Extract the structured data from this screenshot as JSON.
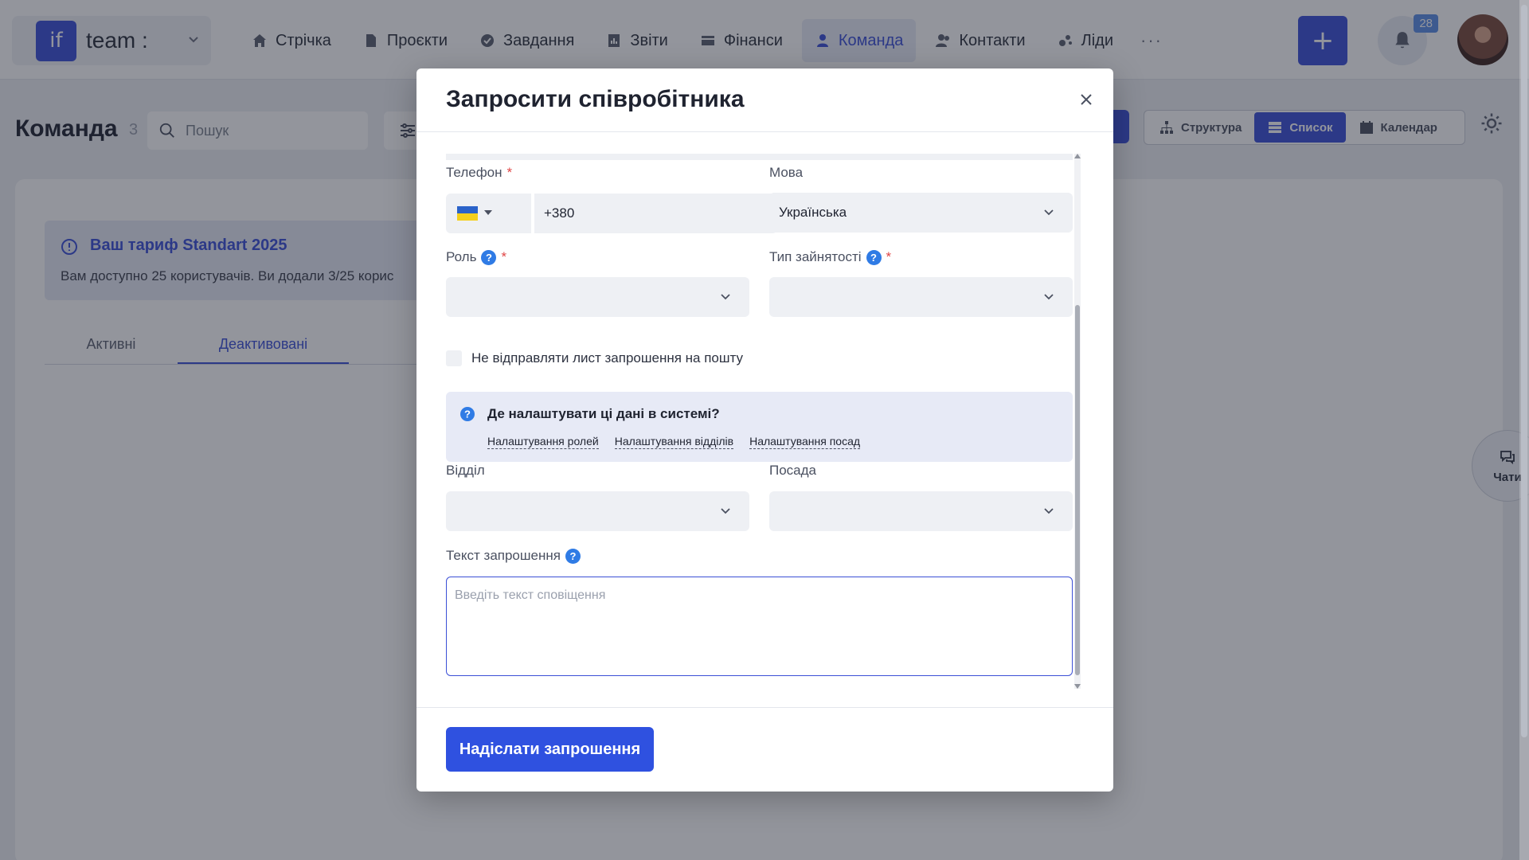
{
  "brand": {
    "logo_text": "if",
    "name": "team :"
  },
  "nav": {
    "items": [
      {
        "label": "Стрічка",
        "icon": "home-icon"
      },
      {
        "label": "Проєкти",
        "icon": "file-icon"
      },
      {
        "label": "Завдання",
        "icon": "check-circle-icon"
      },
      {
        "label": "Звіти",
        "icon": "report-icon"
      },
      {
        "label": "Фінанси",
        "icon": "wallet-icon"
      },
      {
        "label": "Команда",
        "icon": "user-icon",
        "active": true
      },
      {
        "label": "Контакти",
        "icon": "contacts-icon"
      },
      {
        "label": "Ліди",
        "icon": "leads-icon"
      }
    ],
    "more": "···"
  },
  "actions": {
    "plus": "+",
    "notifications_count": "28"
  },
  "page": {
    "title": "Команда",
    "count": "3",
    "search_placeholder": "Пошук",
    "views": [
      {
        "label": "Структура",
        "icon": "structure-icon"
      },
      {
        "label": "Список",
        "icon": "list-icon",
        "active": true
      },
      {
        "label": "Календар",
        "icon": "calendar-icon"
      }
    ]
  },
  "tariff": {
    "title": "Ваш тариф Standart 2025",
    "text": "Вам доступно 25 користувачів. Ви додали 3/25 корис"
  },
  "tabs": [
    {
      "label": "Активні"
    },
    {
      "label": "Деактивовані",
      "active": true
    }
  ],
  "chats": {
    "label": "Чати"
  },
  "modal": {
    "title": "Запросити співробітника",
    "phone": {
      "label": "Телефон",
      "required": "*",
      "value": "+380",
      "country_flag": "ukraine-flag-icon"
    },
    "language": {
      "label": "Мова",
      "value": "Українська"
    },
    "role": {
      "label": "Роль",
      "required": "*",
      "help": "?"
    },
    "employment": {
      "label": "Тип зайнятості",
      "required": "*",
      "help": "?"
    },
    "no_email_checkbox": {
      "label": "Не відправляти лист запрошення на пошту",
      "checked": false
    },
    "info": {
      "help": "?",
      "title": "Де налаштувати ці дані в системі?",
      "links": [
        "Налаштування ролей",
        "Налаштування відділів",
        "Налаштування посад"
      ]
    },
    "department": {
      "label": "Відділ"
    },
    "position": {
      "label": "Посада"
    },
    "invite_text": {
      "label": "Текст запрошення",
      "help": "?",
      "placeholder": "Введіть текст сповіщення"
    },
    "send_button": "Надіслати запрошення"
  },
  "colors": {
    "accent": "#3b4fd6",
    "required": "#e04545",
    "help": "#2f7be5",
    "info_bg": "#e7eaf6"
  }
}
